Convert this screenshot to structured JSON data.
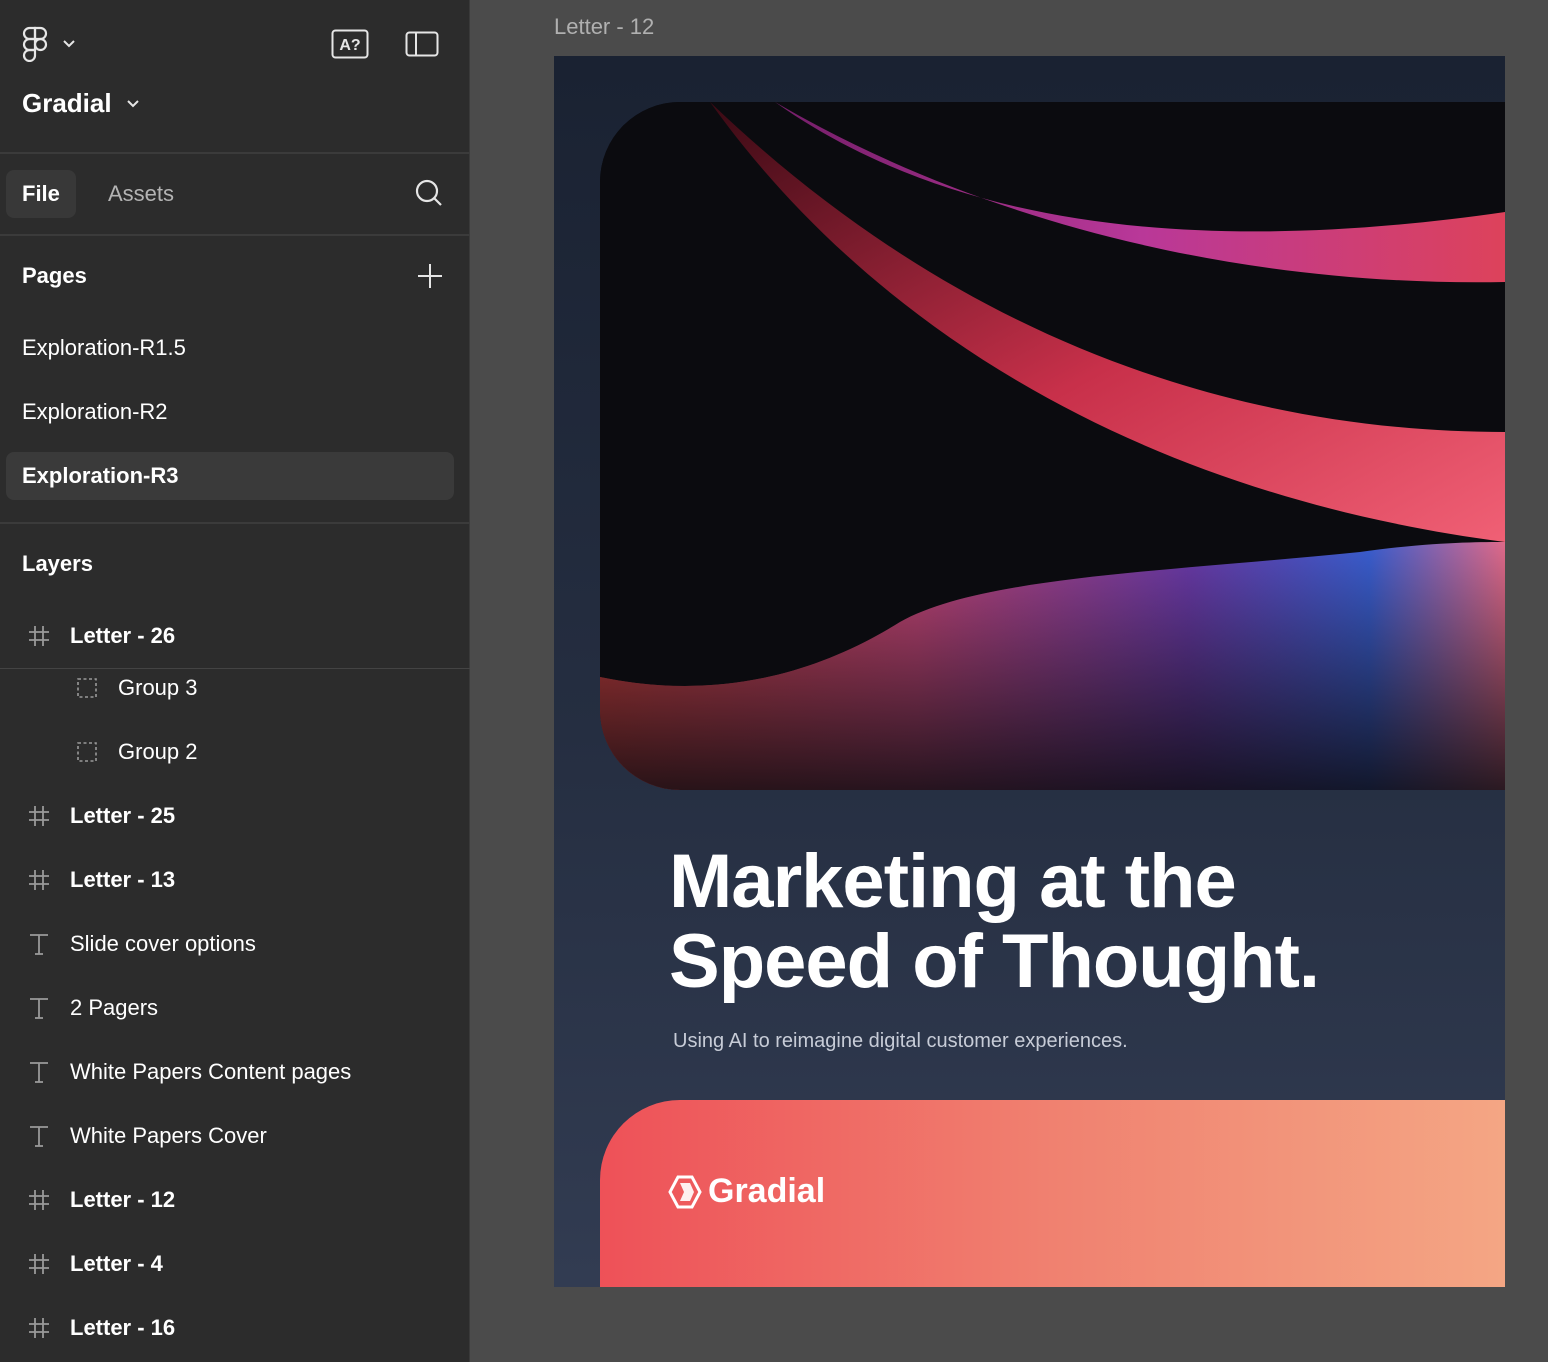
{
  "app": {
    "project_name": "Gradial",
    "tabs": [
      {
        "label": "File"
      },
      {
        "label": "Assets"
      }
    ]
  },
  "pages": {
    "title": "Pages",
    "items": [
      {
        "label": "Exploration-R1.5"
      },
      {
        "label": "Exploration-R2"
      },
      {
        "label": "Exploration-R3"
      }
    ]
  },
  "layers": {
    "title": "Layers",
    "items": [
      {
        "label": "Letter - 26",
        "kind": "frame"
      },
      {
        "label": "Group 3",
        "kind": "group"
      },
      {
        "label": "Group 2",
        "kind": "group"
      },
      {
        "label": "Letter - 25",
        "kind": "frame"
      },
      {
        "label": "Letter - 13",
        "kind": "frame"
      },
      {
        "label": "Slide cover options",
        "kind": "text"
      },
      {
        "label": "2 Pagers",
        "kind": "text"
      },
      {
        "label": "White Papers Content pages",
        "kind": "text"
      },
      {
        "label": "White Papers Cover",
        "kind": "text"
      },
      {
        "label": "Letter - 12",
        "kind": "frame"
      },
      {
        "label": "Letter - 4",
        "kind": "frame"
      },
      {
        "label": "Letter - 16",
        "kind": "frame"
      }
    ]
  },
  "canvas": {
    "frame_label": "Letter - 12",
    "headline_line1": "Marketing at the",
    "headline_line2": "Speed of Thought.",
    "subline": "Using AI to reimagine digital customer experiences.",
    "brand": "Gradial"
  },
  "colors": {
    "sidebar_bg": "#2c2c2c",
    "canvas_bg": "#4b4b4b",
    "footer_start": "#ee5158",
    "footer_end": "#f4a684"
  }
}
